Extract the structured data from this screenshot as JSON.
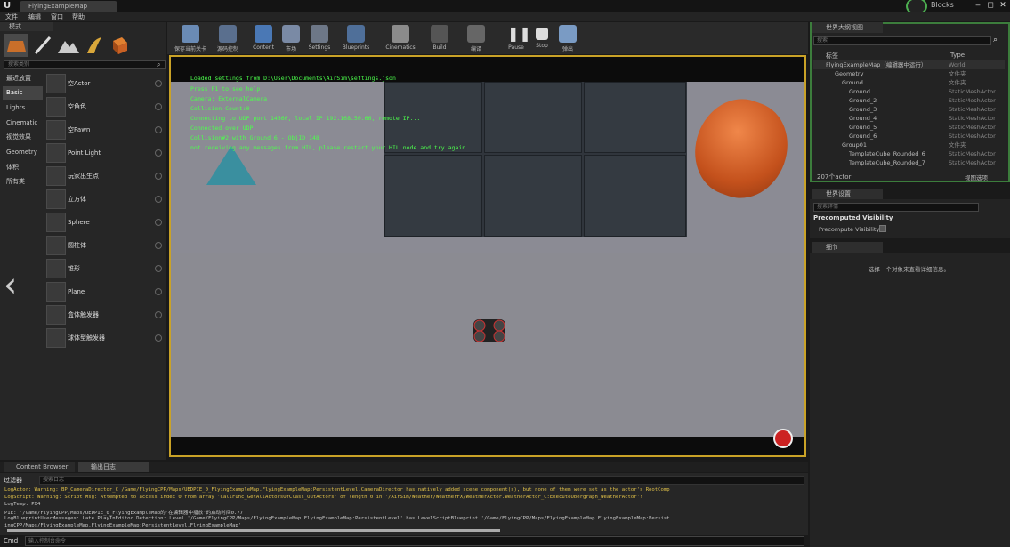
{
  "window": {
    "map_tab": "FlyingExampleMap",
    "project": "Blocks",
    "minimize": "‒",
    "maximize": "◻",
    "close": "✕"
  },
  "menu": [
    "文件",
    "编辑",
    "窗口",
    "帮助"
  ],
  "modes": {
    "header": "模式",
    "search_placeholder": "搜索类别",
    "categories": [
      "最近放置",
      "Basic",
      "Lights",
      "Cinematic",
      "视觉效果",
      "Geometry",
      "体积",
      "所有类"
    ],
    "actors": [
      "空Actor",
      "空角色",
      "空Pawn",
      "Point Light",
      "玩家出生点",
      "立方体",
      "Sphere",
      "圆柱体",
      "锥形",
      "Plane",
      "盒体触发器",
      "球体型触发器"
    ]
  },
  "toolbar": {
    "items": [
      "保存当前关卡",
      "源码控制",
      "Content",
      "市场",
      "Settings",
      "Blueprints",
      "Cinematics",
      "Build",
      "编译",
      "Pause",
      "Stop",
      "弹出"
    ]
  },
  "viewport": {
    "messages": [
      "Loaded settings from D:\\User\\Documents\\AirSim\\settings.json",
      "Press F1 to see help",
      "Camera: ExternalCamera",
      "Collision Count:0",
      "Connecting to UDP port 14560, local IP 192.168.50.66, remote IP...",
      "Connected over UDP.",
      "Collision#2 with Ground_6 - ObjID 148",
      "not receiving any messages from HIL, please restart your HIL node and try again"
    ]
  },
  "outliner": {
    "tab": "世界大纲视图",
    "search_placeholder": "搜索",
    "col_label": "标签",
    "col_type": "Type",
    "rows": [
      {
        "name": "FlyingExampleMap（编辑器中运行）",
        "type": "World"
      },
      {
        "name": "Geometry",
        "type": "文件夹"
      },
      {
        "name": "Ground",
        "type": "文件夹"
      },
      {
        "name": "Ground",
        "type": "StaticMeshActor"
      },
      {
        "name": "Ground_2",
        "type": "StaticMeshActor"
      },
      {
        "name": "Ground_3",
        "type": "StaticMeshActor"
      },
      {
        "name": "Ground_4",
        "type": "StaticMeshActor"
      },
      {
        "name": "Ground_5",
        "type": "StaticMeshActor"
      },
      {
        "name": "Ground_6",
        "type": "StaticMeshActor"
      },
      {
        "name": "Group01",
        "type": "文件夹"
      },
      {
        "name": "TemplateCube_Rounded_6",
        "type": "StaticMeshActor"
      },
      {
        "name": "TemplateCube_Rounded_7",
        "type": "StaticMeshActor"
      }
    ],
    "count": "207个actor",
    "view_options": "视图选项"
  },
  "world_settings": {
    "tab": "世界设置",
    "search_placeholder": "搜索详情",
    "section": "Precomputed Visibility",
    "property": "Precompute Visibility"
  },
  "details": {
    "tab": "细节",
    "empty_message": "选择一个对象来查看详细信息。"
  },
  "output": {
    "tab_content": "Content Browser",
    "tab_log": "输出日志",
    "filter": "过滤器",
    "search_placeholder": "搜索日志",
    "lines": [
      {
        "kind": "warn",
        "text": "LogActor: Warning: BP_CameraDirector_C /Game/FlyingCPP/Maps/UEDPIE_0_FlyingExampleMap.FlyingExampleMap:PersistentLevel.CameraDirector has natively added scene component(s), but none of them were set as the actor's RootComp"
      },
      {
        "kind": "warn",
        "text": "LogScript: Warning: Script Msg: Attempted to access index 0 from array 'CallFunc_GetAllActorsOfClass_OutActors' of length 0 in '/AirSim/Weather/WeatherFX/WeatherActor.WeatherActor_C:ExecuteUbergraph_WeatherActor'!"
      },
      {
        "kind": "norm",
        "text": "LogTemp: PX4"
      },
      {
        "kind": "norm",
        "text": "PIE: '/Game/FlyingCPP/Maps/UEDPIE_0_FlyingExampleMap的'在编辑器中播放'的启动时间0.77"
      },
      {
        "kind": "norm",
        "text": "LogBlueprintUserMessages: Late PlayInEditor Detection: Level '/Game/FlyingCPP/Maps/FlyingExampleMap.FlyingExampleMap:PersistentLevel' has LevelScriptBlueprint '/Game/FlyingCPP/Maps/FlyingExampleMap.FlyingExampleMap:Persist"
      },
      {
        "kind": "norm",
        "text": "ingCPP/Maps/FlyingExampleMap.FlyingExampleMap:PersistentLevel.FlyingExampleMap'"
      }
    ],
    "cmd_label": "Cmd",
    "cmd_placeholder": "输入控制台命令"
  },
  "colors": {
    "viewport_border": "#c9a227",
    "outliner_border": "#3c7d3c",
    "warning_text": "#e0c048",
    "viewport_text": "#4cff4c"
  }
}
